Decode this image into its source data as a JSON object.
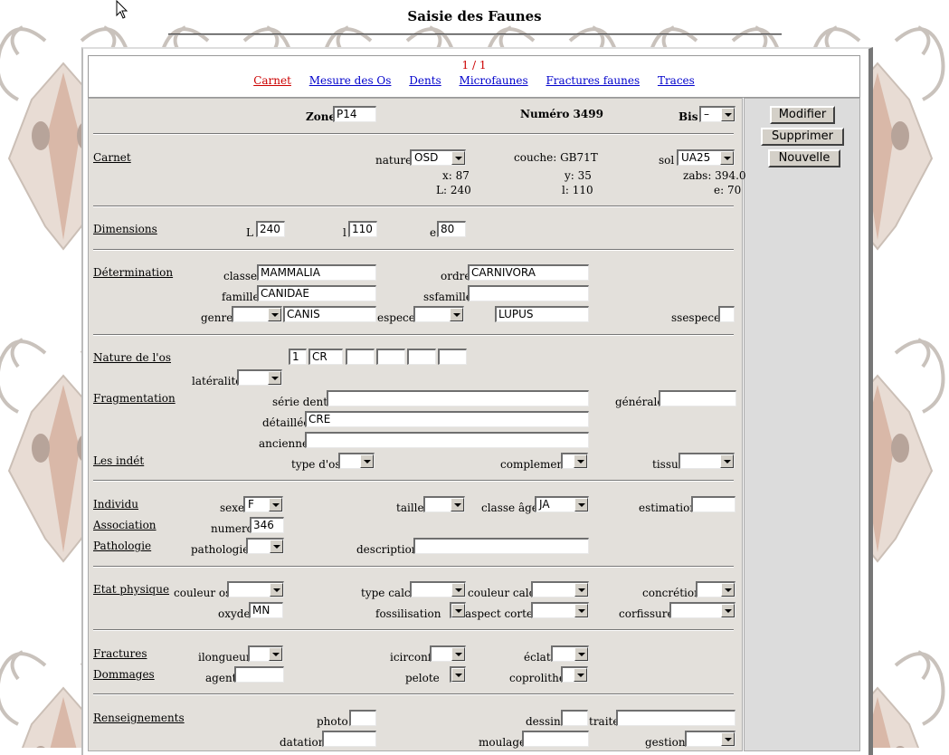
{
  "title": "Saisie des Faunes",
  "record_position": "1 / 1",
  "tabs": [
    "Carnet",
    "Mesure des Os",
    "Dents",
    "Microfaunes",
    "Fractures faunes",
    "Traces"
  ],
  "side_buttons": {
    "modifier": "Modifier",
    "supprimer": "Supprimer",
    "nouvelle": "Nouvelle"
  },
  "header": {
    "zone_label": "Zone",
    "zone_value": "P14",
    "numero": "Numéro 3499",
    "bis_label": "Bis",
    "bis_value": "–"
  },
  "carnet": {
    "section": "Carnet",
    "nature_label": "nature",
    "nature_value": "OSD",
    "couche": "couche: GB71T",
    "sol_label": "sol",
    "sol_value": "UA25",
    "x": "x: 87",
    "y": "y: 35",
    "zabs": "zabs: 394.0",
    "L": "L: 240",
    "l": "l: 110",
    "e": "e: 70"
  },
  "dimensions": {
    "section": "Dimensions",
    "L_label": "L",
    "L_value": "240",
    "l_label": "l",
    "l_value": "110",
    "e_label": "e",
    "e_value": "80"
  },
  "determination": {
    "section": "Détermination",
    "classe_label": "classe",
    "classe_value": "MAMMALIA",
    "ordre_label": "ordre",
    "ordre_value": "CARNIVORA",
    "famille_label": "famille",
    "famille_value": "CANIDAE",
    "ssfamille_label": "ssfamille",
    "ssfamille_value": "",
    "genre_label": "genre",
    "genre_value": "CANIS",
    "espece_label": "espece",
    "espece_value": "LUPUS",
    "ssespece_label": "ssespece"
  },
  "nature_os": {
    "section": "Nature de l'os",
    "n1": "1",
    "n2": "CR",
    "lateralite_label": "latéralité"
  },
  "fragmentation": {
    "section": "Fragmentation",
    "serie_label": "série dentaire",
    "serie_value": "",
    "generale_label": "générale",
    "generale_value": "",
    "detaillee_label": "détaillée",
    "detaillee_value": "CRE",
    "ancienne_label": "ancienne",
    "ancienne_value": ""
  },
  "indet": {
    "section": "Les indét",
    "type_label": "type d'os",
    "complement_label": "complement",
    "tissu_label": "tissu"
  },
  "individu": {
    "section": "Individu",
    "sexe_label": "sexe",
    "sexe_value": "F",
    "taille_label": "taille",
    "classe_age_label": "classe âge",
    "classe_age_value": "JA",
    "estimation_label": "estimation",
    "estimation_value": ""
  },
  "association": {
    "section": "Association",
    "numero_label": "numero",
    "numero_value": "346"
  },
  "pathologie": {
    "section": "Pathologie",
    "pathologie_label": "pathologie",
    "description_label": "description",
    "description_value": ""
  },
  "etat": {
    "section": "Etat physique",
    "couleur_os_label": "couleur os",
    "type_calci_label": "type calci",
    "couleur_calci_label": "couleur calci",
    "concretion_label": "concrétion",
    "oxyde_label": "oxyde",
    "oxyde_value": "MN",
    "fossilisation_label": "fossilisation",
    "aspect_cortex_label": "aspect cortex",
    "corfissure_label": "corfissure"
  },
  "fractures": {
    "section": "Fractures",
    "ilongueur_label": "ilongueur",
    "icirconf_label": "icirconf",
    "eclat_label": "éclat"
  },
  "dommages": {
    "section": "Dommages",
    "agent_label": "agent",
    "agent_value": "",
    "pelote_label": "pelote",
    "coprolithe_label": "coprolithe"
  },
  "renseignements": {
    "section": "Renseignements",
    "photo_label": "photo",
    "dessin_label": "dessin",
    "traite_label": "traite",
    "datation_label": "datation",
    "moulage_label": "moulage",
    "gestion_label": "gestion"
  }
}
